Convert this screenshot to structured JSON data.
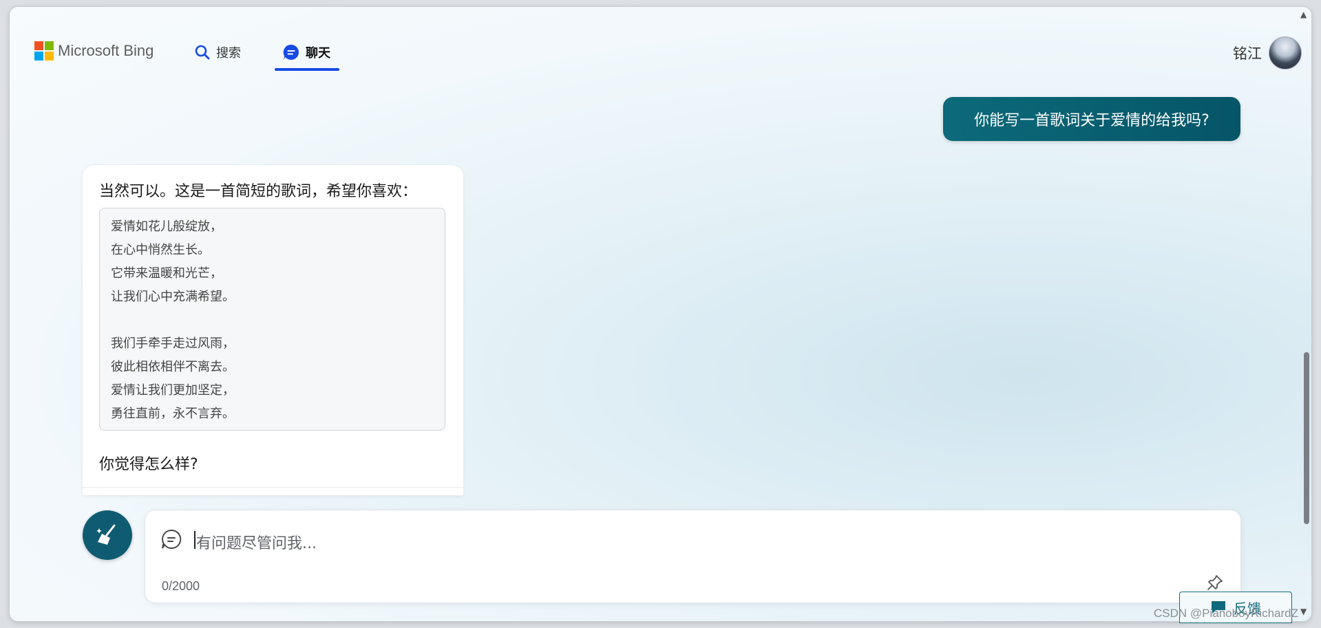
{
  "header": {
    "logo_text": "Microsoft Bing",
    "nav": [
      {
        "label": "搜索",
        "icon": "search-icon"
      },
      {
        "label": "聊天",
        "icon": "chat-icon",
        "active": true
      }
    ],
    "user_name": "铭江"
  },
  "conversation": {
    "user_message": "你能写一首歌词关于爱情的给我吗?",
    "bot_intro": "当然可以。这是一首简短的歌词，希望你喜欢：",
    "lyrics": [
      "爱情如花儿般绽放，",
      "在心中悄然生长。",
      "它带来温暖和光芒，",
      "让我们心中充满希望。",
      "",
      "我们手牵手走过风雨，",
      "彼此相依相伴不离去。",
      "爱情让我们更加坚定，",
      "勇往直前，永不言弃。"
    ],
    "bot_question": "你觉得怎么样?"
  },
  "input": {
    "placeholder": "有问题尽管问我...",
    "char_count": "0/2000"
  },
  "feedback": {
    "label": "反馈"
  },
  "watermark": "CSDN @PianoboyRichardZ",
  "colors": {
    "accent_blue": "#174ae4",
    "teal": "#0f5c72",
    "user_bubble": "#0c6a7a"
  }
}
